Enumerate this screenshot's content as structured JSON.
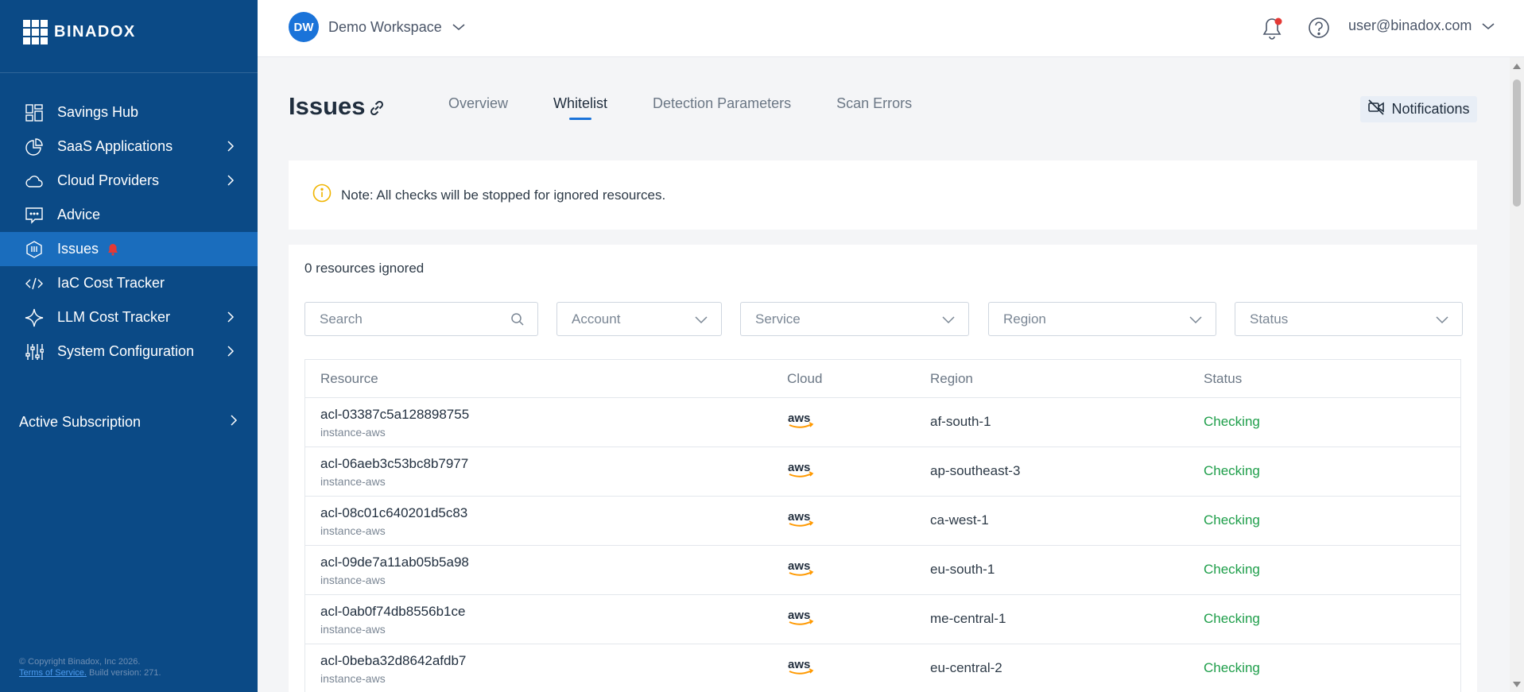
{
  "brand": {
    "name": "BINADOX"
  },
  "sidebar": {
    "items": [
      {
        "label": "Savings Hub",
        "icon": "grid-icon",
        "has_submenu": false,
        "active": false
      },
      {
        "label": "SaaS Applications",
        "icon": "pie-chart-icon",
        "has_submenu": true,
        "active": false
      },
      {
        "label": "Cloud Providers",
        "icon": "cloud-icon",
        "has_submenu": true,
        "active": false
      },
      {
        "label": "Advice",
        "icon": "message-icon",
        "has_submenu": false,
        "active": false
      },
      {
        "label": "Issues",
        "icon": "shield-icon",
        "has_submenu": false,
        "active": true,
        "badge_icon": "bell-icon"
      },
      {
        "label": "IaC Cost Tracker",
        "icon": "code-icon",
        "has_submenu": false,
        "active": false
      },
      {
        "label": "LLM Cost Tracker",
        "icon": "sparkle-icon",
        "has_submenu": true,
        "active": false
      },
      {
        "label": "System Configuration",
        "icon": "sliders-icon",
        "has_submenu": true,
        "active": false
      }
    ],
    "subscription_label": "Active Subscription",
    "footer": {
      "copyright": "© Copyright Binadox, Inc 2026.",
      "tos": "Terms of Service.",
      "build": "Build version: 271."
    }
  },
  "topbar": {
    "workspace_initials": "DW",
    "workspace_name": "Demo Workspace",
    "user_email": "user@binadox.com"
  },
  "page": {
    "title": "Issues",
    "tabs": [
      "Overview",
      "Whitelist",
      "Detection Parameters",
      "Scan Errors"
    ],
    "active_tab": "Whitelist",
    "notifications_label": "Notifications",
    "note": "Note: All checks will be stopped for ignored resources.",
    "count_text": "0 resources ignored"
  },
  "filters": {
    "search_placeholder": "Search",
    "account": "Account",
    "service": "Service",
    "region": "Region",
    "status": "Status"
  },
  "table": {
    "headers": {
      "resource": "Resource",
      "cloud": "Cloud",
      "region": "Region",
      "status": "Status"
    },
    "rows": [
      {
        "name": "acl-03387c5a128898755",
        "type": "instance-aws",
        "cloud": "aws",
        "region": "af-south-1",
        "status": "Checking"
      },
      {
        "name": "acl-06aeb3c53bc8b7977",
        "type": "instance-aws",
        "cloud": "aws",
        "region": "ap-southeast-3",
        "status": "Checking"
      },
      {
        "name": "acl-08c01c640201d5c83",
        "type": "instance-aws",
        "cloud": "aws",
        "region": "ca-west-1",
        "status": "Checking"
      },
      {
        "name": "acl-09de7a11ab05b5a98",
        "type": "instance-aws",
        "cloud": "aws",
        "region": "eu-south-1",
        "status": "Checking"
      },
      {
        "name": "acl-0ab0f74db8556b1ce",
        "type": "instance-aws",
        "cloud": "aws",
        "region": "me-central-1",
        "status": "Checking"
      },
      {
        "name": "acl-0beba32d8642afdb7",
        "type": "instance-aws",
        "cloud": "aws",
        "region": "eu-central-2",
        "status": "Checking"
      }
    ]
  },
  "colors": {
    "sidebar_bg": "#0b4a86",
    "sidebar_active": "#1a6dbd",
    "accent": "#1a73d9",
    "status_checking": "#1e9e4a",
    "alert_red": "#e53935",
    "note_icon": "#f0b400"
  }
}
